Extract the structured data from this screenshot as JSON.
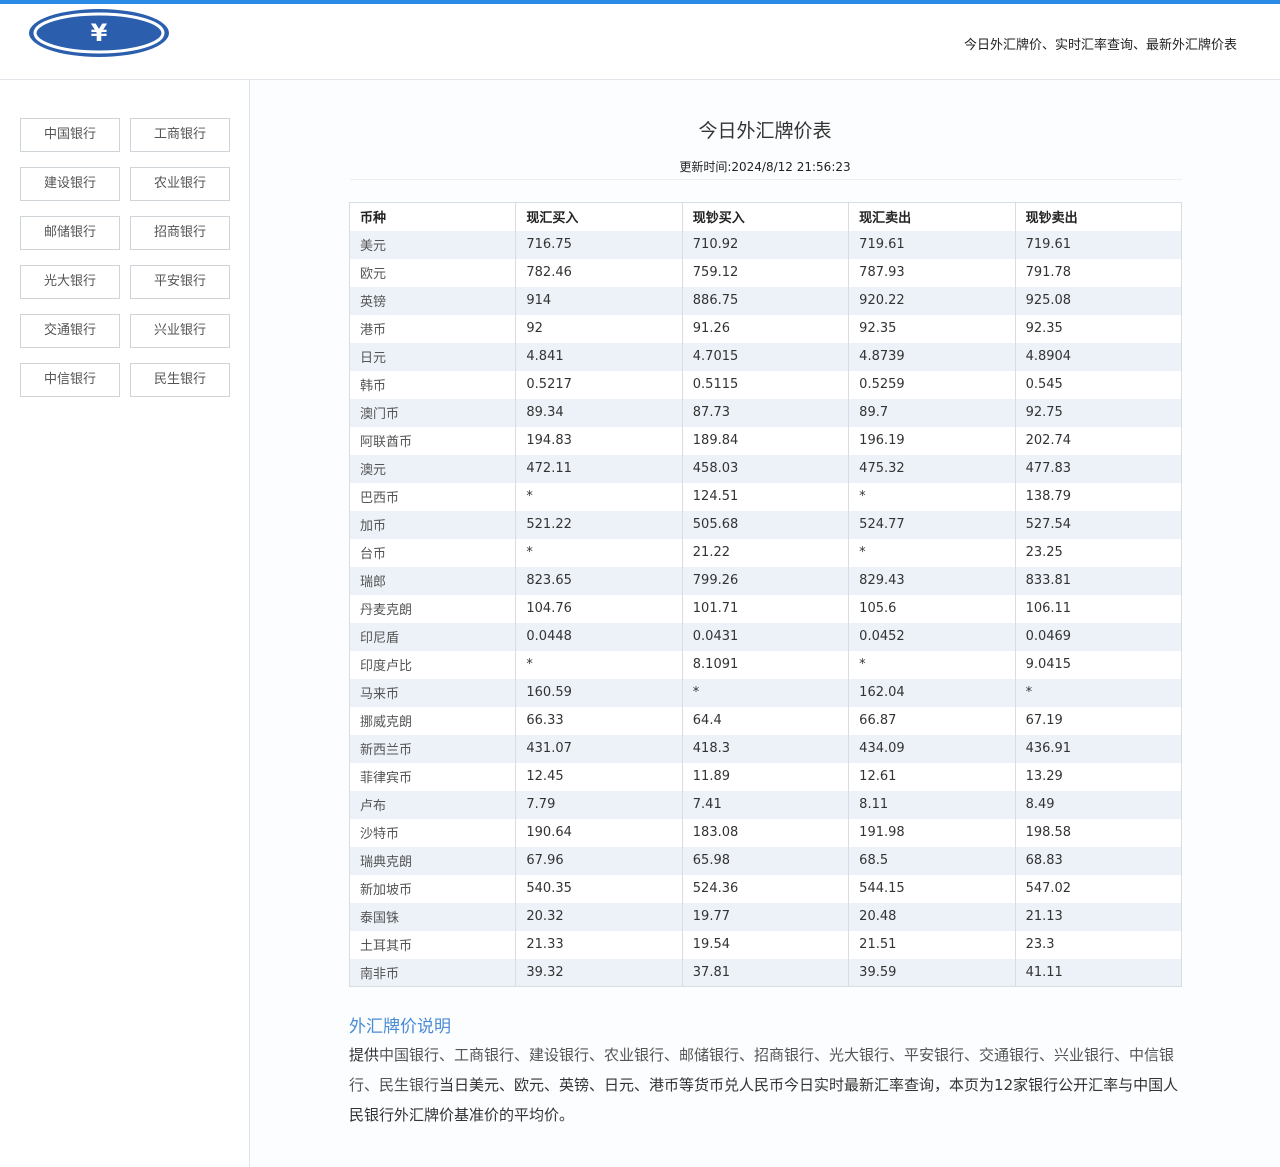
{
  "header": {
    "logo_symbol": "¥",
    "tagline": "今日外汇牌价、实时汇率查询、最新外汇牌价表",
    "accent_color": "#2a8ce6"
  },
  "sidebar": {
    "banks": [
      "中国银行",
      "工商银行",
      "建设银行",
      "农业银行",
      "邮储银行",
      "招商银行",
      "光大银行",
      "平安银行",
      "交通银行",
      "兴业银行",
      "中信银行",
      "民生银行"
    ]
  },
  "main": {
    "title": "今日外汇牌价表",
    "update_time": "更新时间:2024/8/12 21:56:23",
    "table": {
      "headers": [
        "币种",
        "现汇买入",
        "现钞买入",
        "现汇卖出",
        "现钞卖出"
      ],
      "rows": [
        [
          "美元",
          "716.75",
          "710.92",
          "719.61",
          "719.61"
        ],
        [
          "欧元",
          "782.46",
          "759.12",
          "787.93",
          "791.78"
        ],
        [
          "英镑",
          "914",
          "886.75",
          "920.22",
          "925.08"
        ],
        [
          "港币",
          "92",
          "91.26",
          "92.35",
          "92.35"
        ],
        [
          "日元",
          "4.841",
          "4.7015",
          "4.8739",
          "4.8904"
        ],
        [
          "韩币",
          "0.5217",
          "0.5115",
          "0.5259",
          "0.545"
        ],
        [
          "澳门币",
          "89.34",
          "87.73",
          "89.7",
          "92.75"
        ],
        [
          "阿联酋币",
          "194.83",
          "189.84",
          "196.19",
          "202.74"
        ],
        [
          "澳元",
          "472.11",
          "458.03",
          "475.32",
          "477.83"
        ],
        [
          "巴西币",
          "*",
          "124.51",
          "*",
          "138.79"
        ],
        [
          "加币",
          "521.22",
          "505.68",
          "524.77",
          "527.54"
        ],
        [
          "台币",
          "*",
          "21.22",
          "*",
          "23.25"
        ],
        [
          "瑞郎",
          "823.65",
          "799.26",
          "829.43",
          "833.81"
        ],
        [
          "丹麦克朗",
          "104.76",
          "101.71",
          "105.6",
          "106.11"
        ],
        [
          "印尼盾",
          "0.0448",
          "0.0431",
          "0.0452",
          "0.0469"
        ],
        [
          "印度卢比",
          "*",
          "8.1091",
          "*",
          "9.0415"
        ],
        [
          "马来币",
          "160.59",
          "*",
          "162.04",
          "*"
        ],
        [
          "挪威克朗",
          "66.33",
          "64.4",
          "66.87",
          "67.19"
        ],
        [
          "新西兰币",
          "431.07",
          "418.3",
          "434.09",
          "436.91"
        ],
        [
          "菲律宾币",
          "12.45",
          "11.89",
          "12.61",
          "13.29"
        ],
        [
          "卢布",
          "7.79",
          "7.41",
          "8.11",
          "8.49"
        ],
        [
          "沙特币",
          "190.64",
          "183.08",
          "191.98",
          "198.58"
        ],
        [
          "瑞典克朗",
          "67.96",
          "65.98",
          "68.5",
          "68.83"
        ],
        [
          "新加坡币",
          "540.35",
          "524.36",
          "544.15",
          "547.02"
        ],
        [
          "泰国铢",
          "20.32",
          "19.77",
          "20.48",
          "21.13"
        ],
        [
          "土耳其币",
          "21.33",
          "19.54",
          "21.51",
          "23.3"
        ],
        [
          "南非币",
          "39.32",
          "37.81",
          "39.59",
          "41.11"
        ]
      ]
    },
    "description": {
      "title": "外汇牌价说明",
      "lead": "提供",
      "banks_text": "中国银行、工商银行、建设银行、农业银行、邮储银行、招商银行、光大银行、平安银行、交通银行、兴业银行、中信银行、民生银行",
      "body": "当日美元、欧元、英镑、日元、港币等货币兑人民币今日实时最新汇率查询，本页为12家银行公开汇率与中国人民银行外汇牌价基准价的平均价。"
    }
  }
}
